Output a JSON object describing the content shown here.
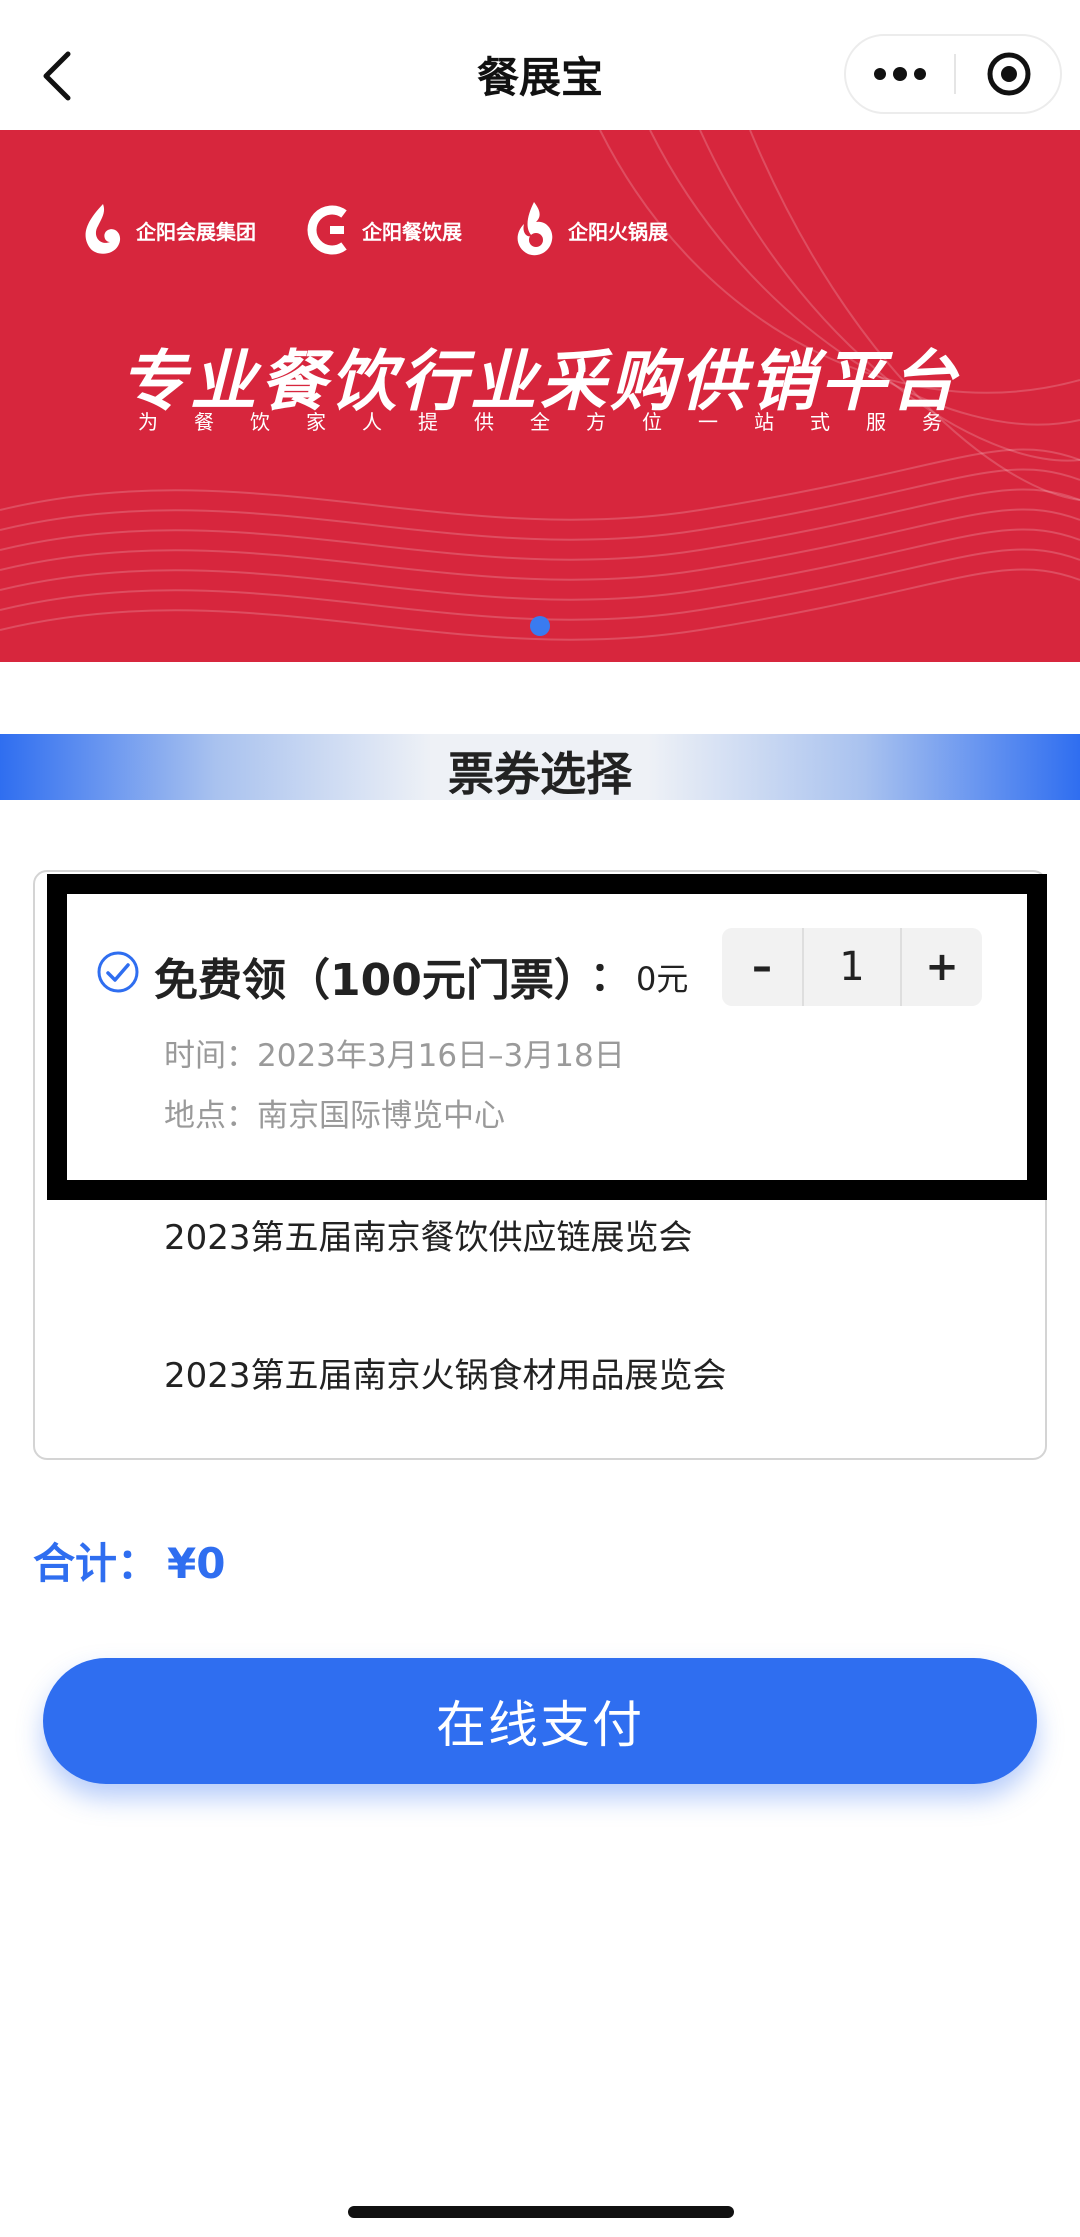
{
  "navbar": {
    "title": "餐展宝",
    "back_icon": "chevron-left-icon",
    "more_icon": "more-dots-icon",
    "close_icon": "target-close-icon"
  },
  "banner": {
    "logos": [
      {
        "name": "企阳会展集团",
        "icon": "flame-logo-icon"
      },
      {
        "name": "企阳餐饮展",
        "icon": "qmfe-logo-icon"
      },
      {
        "name": "企阳火锅展",
        "icon": "hotpot-logo-icon"
      }
    ],
    "title": "专业餐饮行业采购供销平台",
    "subtitle": "为餐饮家人提供全方位一站式服务",
    "background_color": "#d7263d",
    "carousel_dot_color": "#3a7bf0"
  },
  "section": {
    "title": "票券选择"
  },
  "ticket": {
    "checked": true,
    "check_icon": "check-circle-icon",
    "name": "免费领（100元门票）",
    "colon": "：",
    "price": "0元",
    "quantity": "1",
    "minus_label": "–",
    "plus_label": "+",
    "time": "时间：2023年3月16日–3月18日",
    "place": "地点：南京国际博览中心",
    "expos": [
      "2023第五届南京餐饮供应链展览会",
      "2023第五届南京火锅食材用品展览会"
    ]
  },
  "total": {
    "label": "合计：",
    "value": "¥0"
  },
  "pay_button": {
    "label": "在线支付"
  },
  "colors": {
    "accent": "#2f6ef0",
    "muted_text": "#9a9a9a"
  }
}
